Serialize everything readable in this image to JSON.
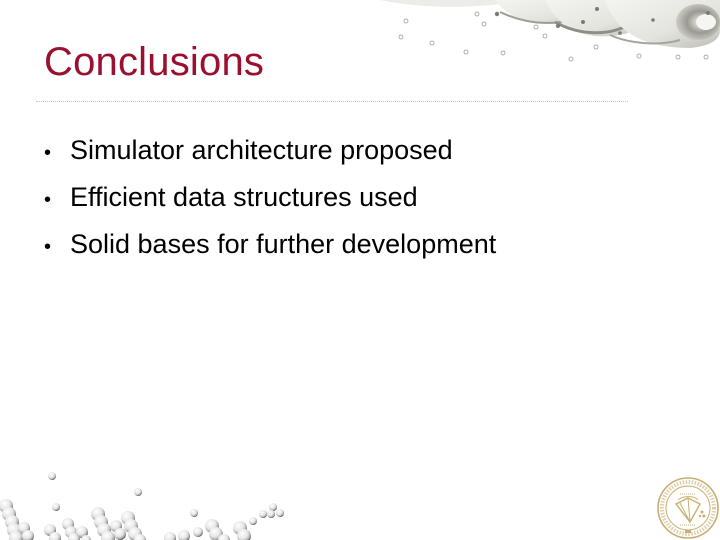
{
  "slide": {
    "title": "Conclusions",
    "bullet_symbol": "•",
    "bullets": [
      "Simulator architecture proposed",
      "Efficient data structures used",
      "Solid bases for further development"
    ]
  },
  "decorations": {
    "top_right": "abstract-swirl-with-droplets",
    "bottom_left": "particle-spheres-simulation",
    "bottom_right": "university-seal"
  },
  "colors": {
    "title": "#9b1030",
    "body_text": "#000000",
    "separator": "#c6c6c6",
    "seal": "#c8ae72"
  }
}
